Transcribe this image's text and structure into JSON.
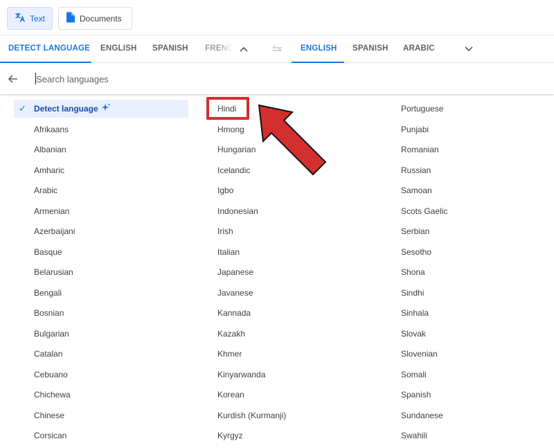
{
  "mode_buttons": {
    "text_label": "Text",
    "documents_label": "Documents"
  },
  "source_tabs": [
    "DETECT LANGUAGE",
    "ENGLISH",
    "SPANISH",
    "FRENCH"
  ],
  "target_tabs": [
    "ENGLISH",
    "SPANISH",
    "ARABIC"
  ],
  "search": {
    "placeholder": "Search languages",
    "value": ""
  },
  "languages": {
    "column1": [
      "Detect language",
      "Afrikaans",
      "Albanian",
      "Amharic",
      "Arabic",
      "Armenian",
      "Azerbaijani",
      "Basque",
      "Belarusian",
      "Bengali",
      "Bosnian",
      "Bulgarian",
      "Catalan",
      "Cebuano",
      "Chichewa",
      "Chinese",
      "Corsican"
    ],
    "column2": [
      "Hindi",
      "Hmong",
      "Hungarian",
      "Icelandic",
      "Igbo",
      "Indonesian",
      "Irish",
      "Italian",
      "Japanese",
      "Javanese",
      "Kannada",
      "Kazakh",
      "Khmer",
      "Kinyarwanda",
      "Korean",
      "Kurdish (Kurmanji)",
      "Kyrgyz"
    ],
    "column3": [
      "Portuguese",
      "Punjabi",
      "Romanian",
      "Russian",
      "Samoan",
      "Scots Gaelic",
      "Serbian",
      "Sesotho",
      "Shona",
      "Sindhi",
      "Sinhala",
      "Slovak",
      "Slovenian",
      "Somali",
      "Spanish",
      "Sundanese",
      "Swahili"
    ]
  },
  "selected_language": "Detect language",
  "highlighted_language": "Hindi",
  "colors": {
    "accent": "#1a73e8",
    "selected_bg": "#e8f0fe",
    "annotation_red": "#d32f2f"
  },
  "icons": [
    "translate-icon",
    "document-icon",
    "chevron-up-icon",
    "swap-icon",
    "chevron-down-icon",
    "back-arrow-icon",
    "check-icon",
    "sparkle-icon"
  ]
}
